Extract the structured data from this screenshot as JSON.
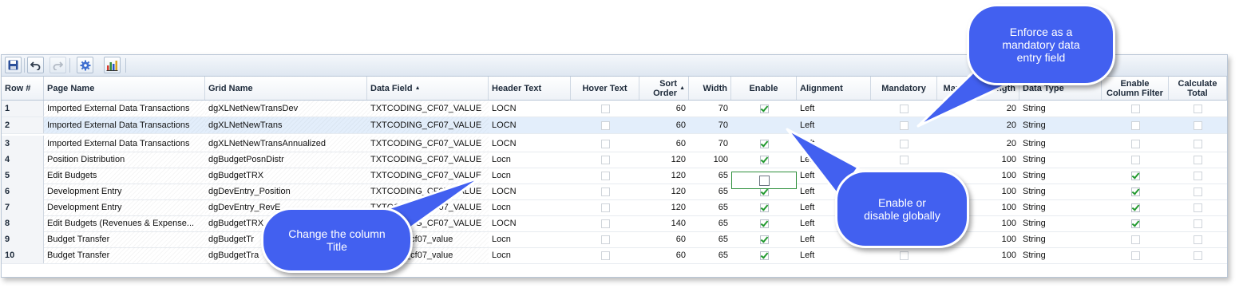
{
  "toolbar": {
    "icons": [
      "save-icon",
      "undo-icon",
      "redo-icon",
      "settings-gear-icon",
      "chart-icon"
    ]
  },
  "columns": [
    {
      "key": "row",
      "label": "Row #",
      "align": "left"
    },
    {
      "key": "page",
      "label": "Page Name",
      "align": "left"
    },
    {
      "key": "grid",
      "label": "Grid Name",
      "align": "left"
    },
    {
      "key": "field",
      "label": "Data Field",
      "align": "left",
      "sort": "asc"
    },
    {
      "key": "header",
      "label": "Header Text",
      "align": "left"
    },
    {
      "key": "hover",
      "label": "Hover Text",
      "align": "center"
    },
    {
      "key": "sort",
      "label": "Sort Order",
      "align": "right",
      "sort": "asc"
    },
    {
      "key": "width",
      "label": "Width",
      "align": "right"
    },
    {
      "key": "enable",
      "label": "Enable",
      "align": "center"
    },
    {
      "key": "align",
      "label": "Alignment",
      "align": "left"
    },
    {
      "key": "mandatory",
      "label": "Mandatory",
      "align": "center"
    },
    {
      "key": "maxlen",
      "label": "Maximum Length",
      "align": "right"
    },
    {
      "key": "dtype",
      "label": "Data Type",
      "align": "left"
    },
    {
      "key": "colfilter",
      "label": "Enable Column Filter",
      "align": "center"
    },
    {
      "key": "calc",
      "label": "Calculate Total",
      "align": "center"
    }
  ],
  "rows": [
    {
      "row": "1",
      "page": "Imported External Data Transactions",
      "grid": "dgXLNetNewTransDev",
      "field": "TXTCODING_CF07_VALUE",
      "header": "LOCN",
      "hover": false,
      "sort": "60",
      "width": "70",
      "enable": true,
      "align": "Left",
      "mandatory": false,
      "maxlen": "20",
      "dtype": "String",
      "colfilter": false,
      "calc": false
    },
    {
      "row": "2",
      "page": "Imported External Data Transactions",
      "grid": "dgXLNetNewTrans",
      "field": "TXTCODING_CF07_VALUE",
      "header": "LOCN",
      "hover": false,
      "sort": "60",
      "width": "70",
      "enable": false,
      "align": "Left",
      "mandatory": false,
      "maxlen": "20",
      "dtype": "String",
      "colfilter": false,
      "calc": false,
      "selected": true
    },
    {
      "row": "3",
      "page": "Imported External Data Transactions",
      "grid": "dgXLNetNewTransAnnualized",
      "field": "TXTCODING_CF07_VALUE",
      "header": "LOCN",
      "hover": false,
      "sort": "60",
      "width": "70",
      "enable": true,
      "align": "Left",
      "mandatory": false,
      "maxlen": "20",
      "dtype": "String",
      "colfilter": false,
      "calc": false
    },
    {
      "row": "4",
      "page": "Position Distribution",
      "grid": "dgBudgetPosnDistr",
      "field": "TXTCODING_CF07_VALUE",
      "header": "Locn",
      "hover": false,
      "sort": "120",
      "width": "100",
      "enable": true,
      "align": "Left",
      "mandatory": false,
      "maxlen": "100",
      "dtype": "String",
      "colfilter": false,
      "calc": false
    },
    {
      "row": "5",
      "page": "Edit Budgets",
      "grid": "dgBudgetTRX",
      "field": "TXTCODING_CF07_VALUE",
      "header": "Locn",
      "hover": false,
      "sort": "120",
      "width": "65",
      "enable": true,
      "align": "Left",
      "mandatory": false,
      "maxlen": "100",
      "dtype": "String",
      "colfilter": true,
      "calc": false
    },
    {
      "row": "6",
      "page": "Development Entry",
      "grid": "dgDevEntry_Position",
      "field": "TXTCODING_CF07_VALUE",
      "header": "LOCN",
      "hover": false,
      "sort": "120",
      "width": "65",
      "enable": true,
      "align": "Left",
      "mandatory": false,
      "maxlen": "100",
      "dtype": "String",
      "colfilter": true,
      "calc": false
    },
    {
      "row": "7",
      "page": "Development Entry",
      "grid": "dgDevEntry_RevE",
      "field": "TXTCODING_CF07_VALUE",
      "header": "Locn",
      "hover": false,
      "sort": "120",
      "width": "65",
      "enable": true,
      "align": "Left",
      "mandatory": false,
      "maxlen": "100",
      "dtype": "String",
      "colfilter": true,
      "calc": false
    },
    {
      "row": "8",
      "page": "Edit Budgets (Revenues & Expense...",
      "grid": "dgBudgetTRX",
      "field": "TXTCODING_CF07_VALUE",
      "header": "LOCN",
      "hover": false,
      "sort": "140",
      "width": "65",
      "enable": true,
      "align": "Left",
      "mandatory": false,
      "maxlen": "100",
      "dtype": "String",
      "colfilter": true,
      "calc": false
    },
    {
      "row": "9",
      "page": "Budget Transfer",
      "grid": "dgBudgetTr",
      "field": "txtcoding_cf07_value",
      "header": "Locn",
      "hover": false,
      "sort": "60",
      "width": "65",
      "enable": true,
      "align": "Left",
      "mandatory": false,
      "maxlen": "100",
      "dtype": "String",
      "colfilter": false,
      "calc": false
    },
    {
      "row": "10",
      "page": "Budget Transfer",
      "grid": "dgBudgetTra",
      "field": "txtcoding_cf07_value",
      "header": "Locn",
      "hover": false,
      "sort": "60",
      "width": "65",
      "enable": true,
      "align": "Left",
      "mandatory": false,
      "maxlen": "100",
      "dtype": "String",
      "colfilter": false,
      "calc": false
    }
  ],
  "callouts": {
    "mandatory": [
      "Enforce as a",
      "mandatory data",
      "entry field"
    ],
    "enable": [
      "Enable or",
      "disable globally"
    ],
    "title": [
      "Change the column",
      "Title"
    ]
  },
  "colors": {
    "callout_fill": "#4260f0",
    "check_green": "#22992f",
    "selected_row": "#e3eefb"
  }
}
